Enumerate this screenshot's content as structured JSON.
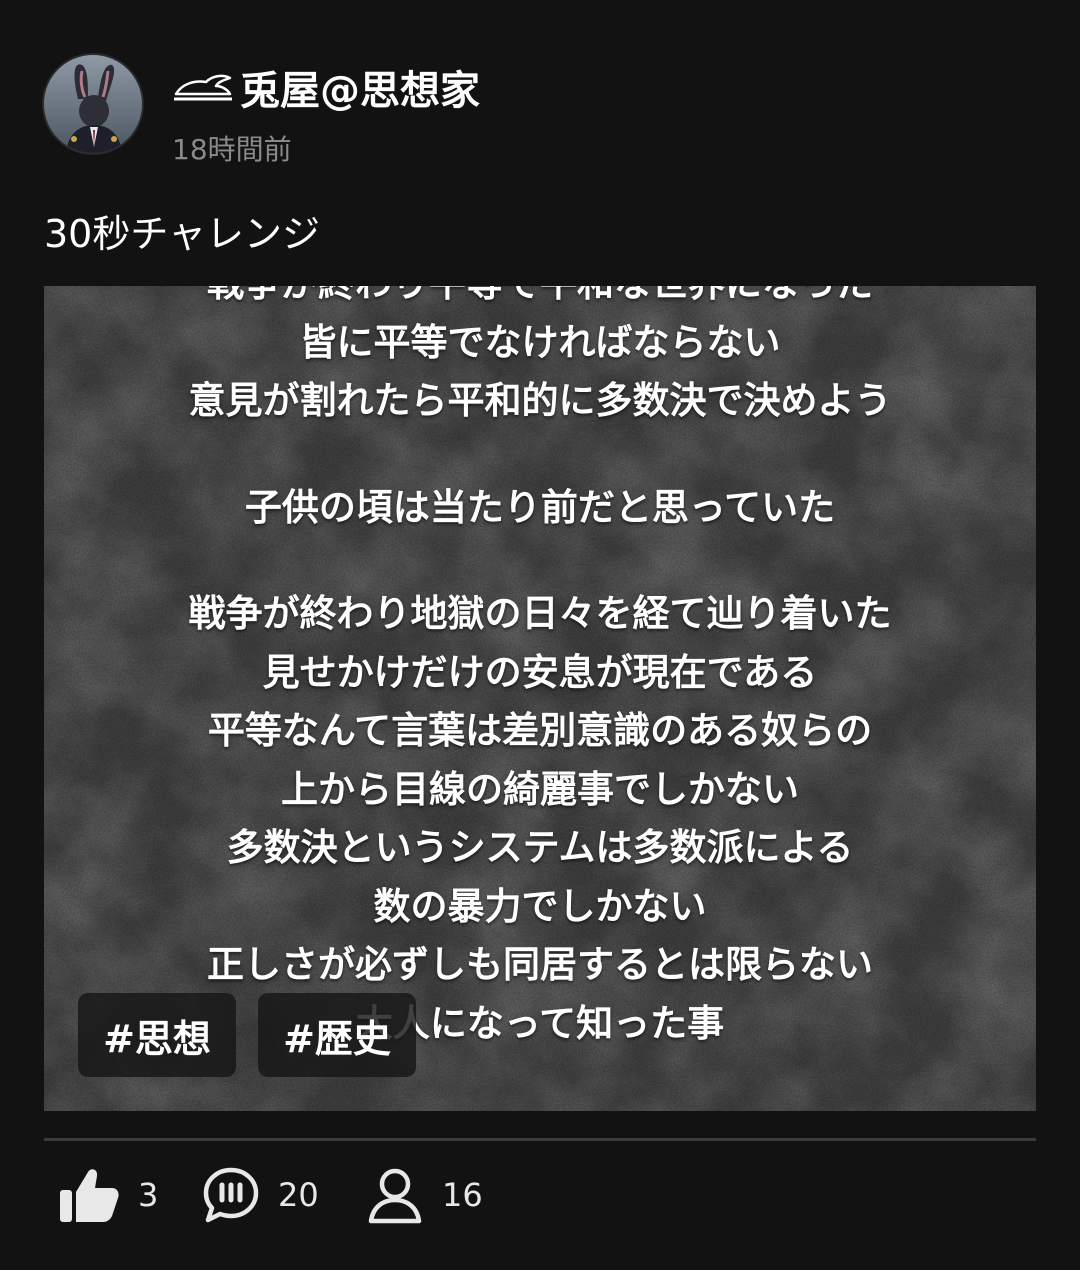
{
  "post": {
    "author": "兎屋@思想家",
    "timestamp": "18時間前",
    "caption": "30秒チャレンジ"
  },
  "media": {
    "lines": [
      "戦争が終わり平等で平和な世界になった",
      "皆に平等でなければならない",
      "意見が割れたら平和的に多数決で決めよう",
      "",
      "子供の頃は当たり前だと思っていた",
      "",
      "戦争が終わり地獄の日々を経て辿り着いた",
      "見せかけだけの安息が現在である",
      "平等なんて言葉は差別意識のある奴らの",
      "上から目線の綺麗事でしかない",
      "多数決というシステムは多数派による",
      "数の暴力でしかない",
      "正しさが必ずしも同居するとは限らない",
      "大人になって知った事"
    ],
    "tags": [
      "#思想",
      "#歴史"
    ]
  },
  "stats": {
    "likes": "3",
    "comments": "20",
    "participants": "16"
  },
  "icons": {
    "author_mark": "rabbit-mark-icon",
    "like": "thumbs-up-icon",
    "comment": "comment-bubble-icon",
    "participants": "person-icon"
  },
  "colors": {
    "background": "#121212",
    "secondary_text": "#8a8a8a"
  }
}
